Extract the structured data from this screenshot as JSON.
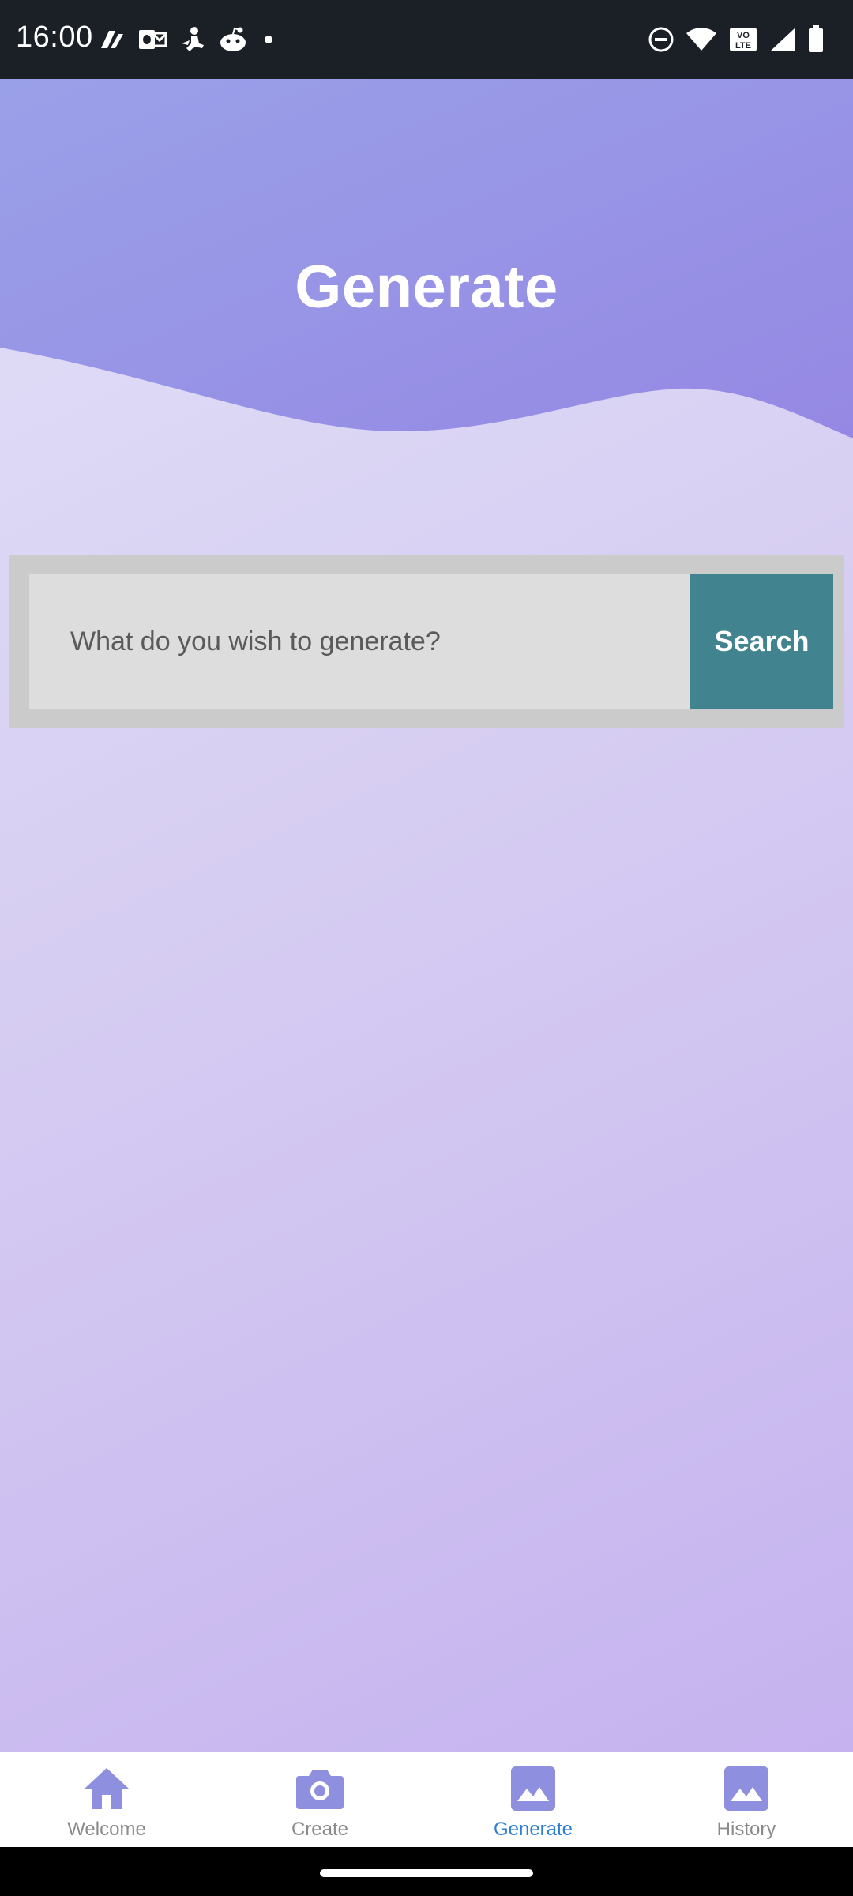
{
  "status_bar": {
    "time": "16:00",
    "left_icons": [
      "vpn-key-icon",
      "outlook-icon",
      "reading-icon",
      "reddit-icon",
      "notification-dot-icon"
    ],
    "right_icons": [
      "do-not-disturb-icon",
      "wifi-icon",
      "volte-icon",
      "signal-icon",
      "battery-icon"
    ]
  },
  "header": {
    "title": "Generate"
  },
  "search": {
    "placeholder": "What do you wish to generate?",
    "button_label": "Search"
  },
  "bottom_nav": {
    "items": [
      {
        "label": "Welcome",
        "icon": "home-icon",
        "active": false
      },
      {
        "label": "Create",
        "icon": "camera-icon",
        "active": false
      },
      {
        "label": "Generate",
        "icon": "image-icon",
        "active": true
      },
      {
        "label": "History",
        "icon": "image-icon",
        "active": false
      }
    ]
  },
  "colors": {
    "accent_nav": "#8f8fe0",
    "active_label": "#2f7fd6",
    "search_button": "#418490",
    "header_gradient_start": "#9aa0e8",
    "header_gradient_end": "#9588e4"
  }
}
